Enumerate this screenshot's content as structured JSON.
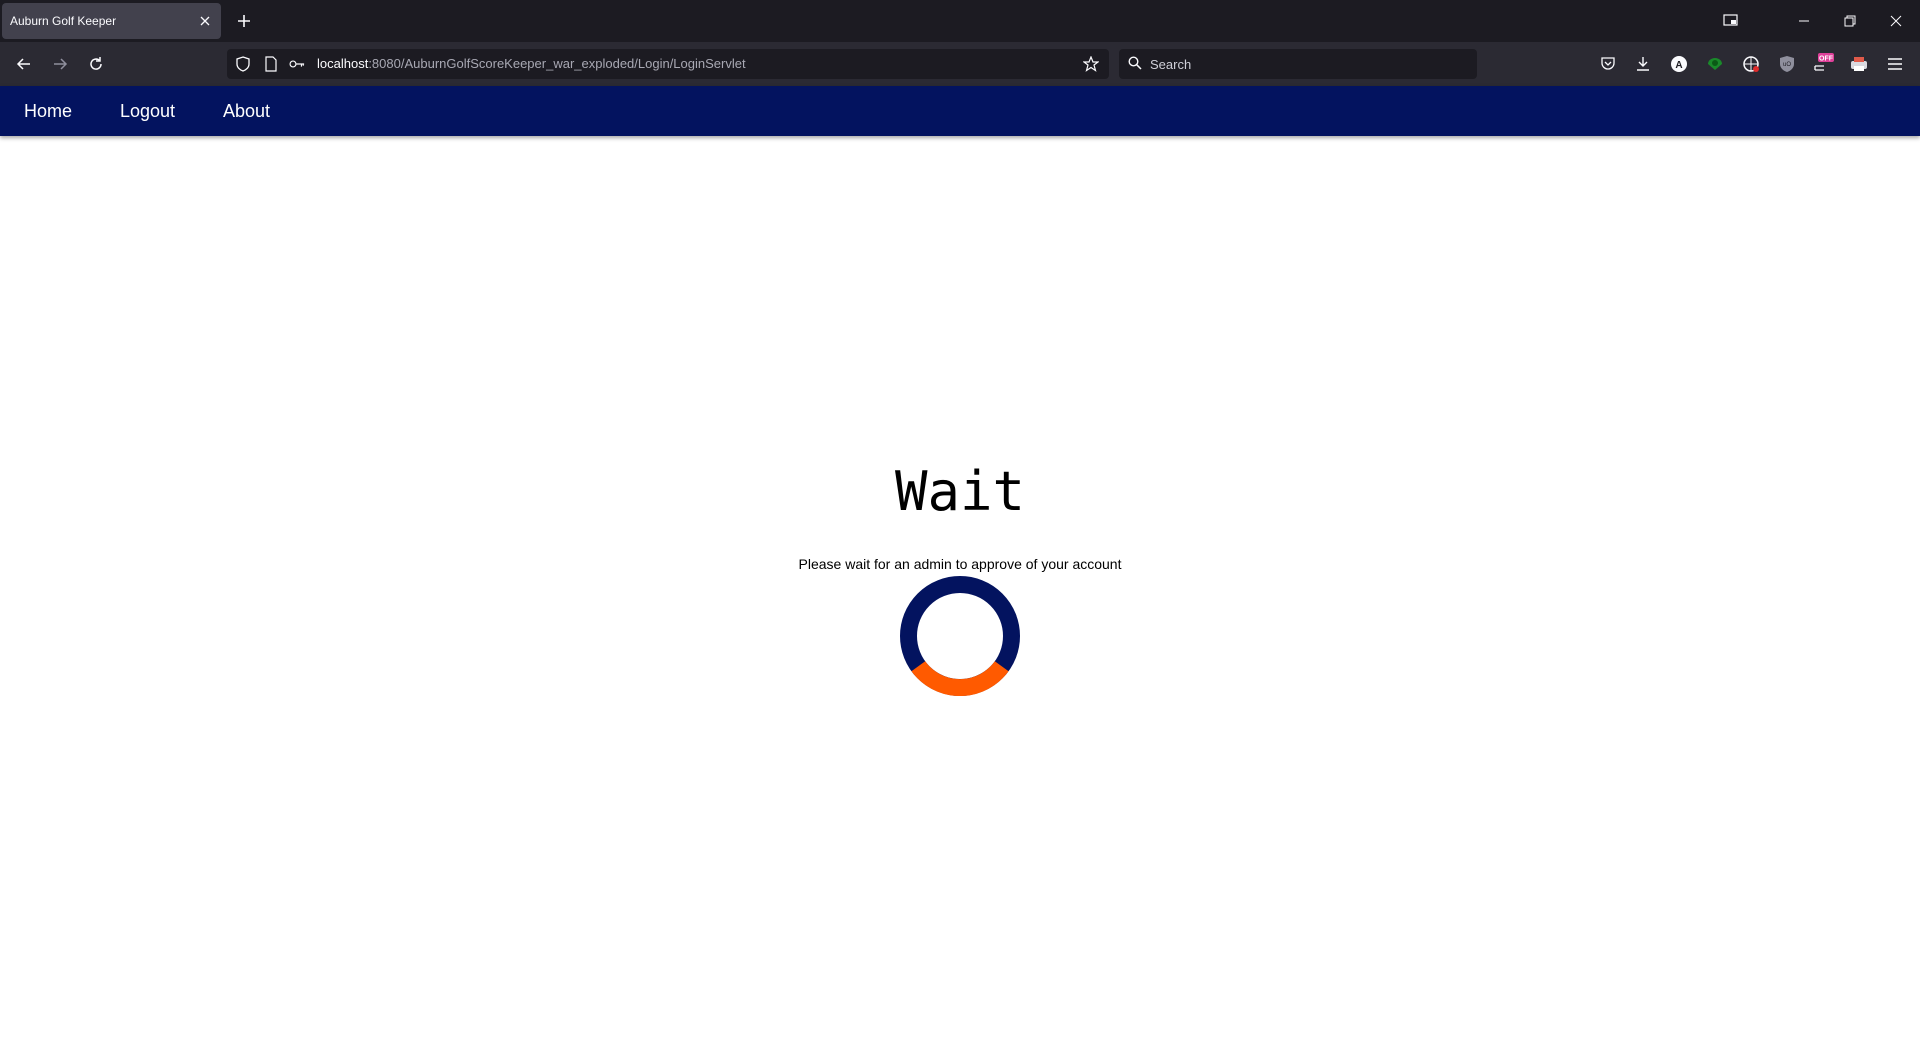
{
  "browser": {
    "tab_title": "Auburn Golf Keeper",
    "url_host": "localhost",
    "url_rest": ":8080/AuburnGolfScoreKeeper_war_exploded/Login/LoginServlet",
    "search_placeholder": "Search",
    "extension_badge": "OFF"
  },
  "nav": {
    "home": "Home",
    "logout": "Logout",
    "about": "About"
  },
  "main": {
    "title": "Wait",
    "message": "Please wait for an admin to approve of your account"
  },
  "colors": {
    "nav_bg": "#03135f",
    "spinner_track": "#03135f",
    "spinner_accent": "#ff5a00"
  }
}
